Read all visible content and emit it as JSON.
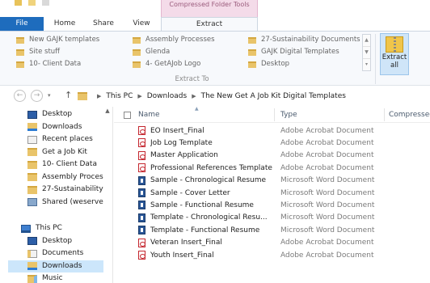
{
  "window": {
    "contextual_tab_group": "Compressed Folder Tools"
  },
  "tabs": [
    {
      "label": "File"
    },
    {
      "label": "Home"
    },
    {
      "label": "Share"
    },
    {
      "label": "View"
    },
    {
      "label": "Extract"
    }
  ],
  "ribbon": {
    "destinations": [
      [
        "New GAJK templates",
        "Site stuff",
        "10- Client Data"
      ],
      [
        "Assembly Processes",
        "Glenda",
        "4- GetAJob Logo"
      ],
      [
        "27-Sustainability Documents",
        "GAJK Digital Templates",
        "Desktop"
      ]
    ],
    "group_label": "Extract To",
    "extract_all_line1": "Extract",
    "extract_all_line2": "all"
  },
  "address": {
    "breadcrumbs": [
      "This PC",
      "Downloads",
      "The New Get A Job Kit Digital Templates"
    ]
  },
  "nav_pane": {
    "quick_access": [
      {
        "label": "Desktop",
        "icon": "desktop-icon"
      },
      {
        "label": "Downloads",
        "icon": "downloads-icon"
      },
      {
        "label": "Recent places",
        "icon": "recent-places-icon"
      },
      {
        "label": "Get a Job Kit",
        "icon": "folder-icon"
      },
      {
        "label": "10- Client Data",
        "icon": "folder-icon"
      },
      {
        "label": "Assembly Proces",
        "icon": "folder-icon"
      },
      {
        "label": "27-Sustainability",
        "icon": "folder-icon"
      },
      {
        "label": "Shared (weserver",
        "icon": "network-drive-icon"
      }
    ],
    "this_pc": {
      "label": "This PC",
      "icon": "computer-icon"
    },
    "this_pc_items": [
      {
        "label": "Desktop",
        "icon": "desktop-folder-icon"
      },
      {
        "label": "Documents",
        "icon": "documents-folder-icon"
      },
      {
        "label": "Downloads",
        "icon": "downloads-folder-icon",
        "selected": true
      },
      {
        "label": "Music",
        "icon": "music-folder-icon"
      }
    ]
  },
  "file_list": {
    "columns": {
      "name": "Name",
      "type": "Type",
      "compressed": "Compressed"
    },
    "files": [
      {
        "name": "EO Insert_Final",
        "type": "Adobe Acrobat Document",
        "icon": "pdf-icon"
      },
      {
        "name": "Job Log Template",
        "type": "Adobe Acrobat Document",
        "icon": "pdf-icon"
      },
      {
        "name": "Master Application",
        "type": "Adobe Acrobat Document",
        "icon": "pdf-icon"
      },
      {
        "name": "Professional References Template",
        "type": "Adobe Acrobat Document",
        "icon": "pdf-icon"
      },
      {
        "name": "Sample - Chronological Resume",
        "type": "Microsoft Word Document",
        "icon": "word-doc-icon"
      },
      {
        "name": "Sample - Cover Letter",
        "type": "Microsoft Word Document",
        "icon": "word-doc-icon"
      },
      {
        "name": "Sample - Functional Resume",
        "type": "Microsoft Word Document",
        "icon": "word-doc-icon"
      },
      {
        "name": "Template - Chronological Resu...",
        "type": "Microsoft Word Document",
        "icon": "word-doc-icon"
      },
      {
        "name": "Template - Functional Resume",
        "type": "Microsoft Word Document",
        "icon": "word-doc-icon"
      },
      {
        "name": "Veteran Insert_Final",
        "type": "Adobe Acrobat Document",
        "icon": "pdf-icon"
      },
      {
        "name": "Youth Insert_Final",
        "type": "Adobe Acrobat Document",
        "icon": "pdf-icon"
      }
    ]
  },
  "colors": {
    "file_tab": "#1e6cbd",
    "contextual_band": "#f4dbe9",
    "selection": "#cce6fb",
    "pdf_red": "#c4262e",
    "word_blue": "#2b5797"
  }
}
